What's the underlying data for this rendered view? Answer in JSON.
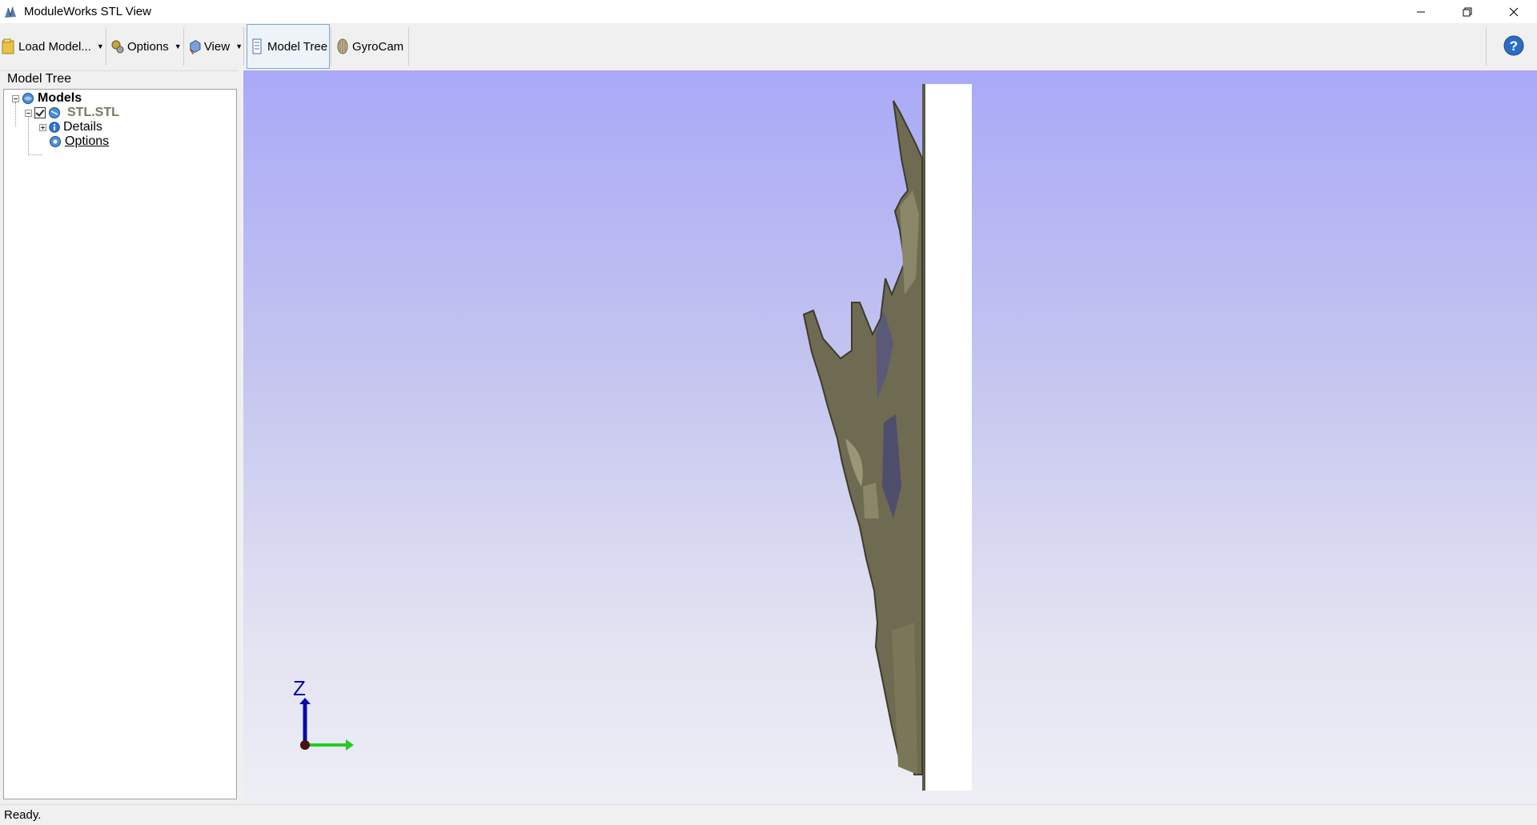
{
  "window": {
    "title": "ModuleWorks STL View",
    "controls": {
      "minimize_icon": "minimize-icon",
      "restore_icon": "restore-icon",
      "close_icon": "close-icon"
    }
  },
  "toolbar": {
    "load_model": "Load Model...",
    "options": "Options",
    "view": "View",
    "model_tree": "Model Tree",
    "gyrocam": "GyroCam",
    "help_icon": "help-icon",
    "dropdown_glyph": "▼"
  },
  "model_tree": {
    "panel_title": "Model Tree",
    "root": "Models",
    "model": "STL.STL",
    "children": [
      "Details",
      "Options"
    ],
    "model_checked": true
  },
  "viewport": {
    "axis_label_z": "Z",
    "colors": {
      "background_top": "#a9a9f8",
      "background_bottom": "#eeeef5",
      "model": "#6e6b52",
      "stock": "#ffffff",
      "axis_z": "#1010c0",
      "axis_x": "#22cc22"
    }
  },
  "status": {
    "text": "Ready."
  }
}
